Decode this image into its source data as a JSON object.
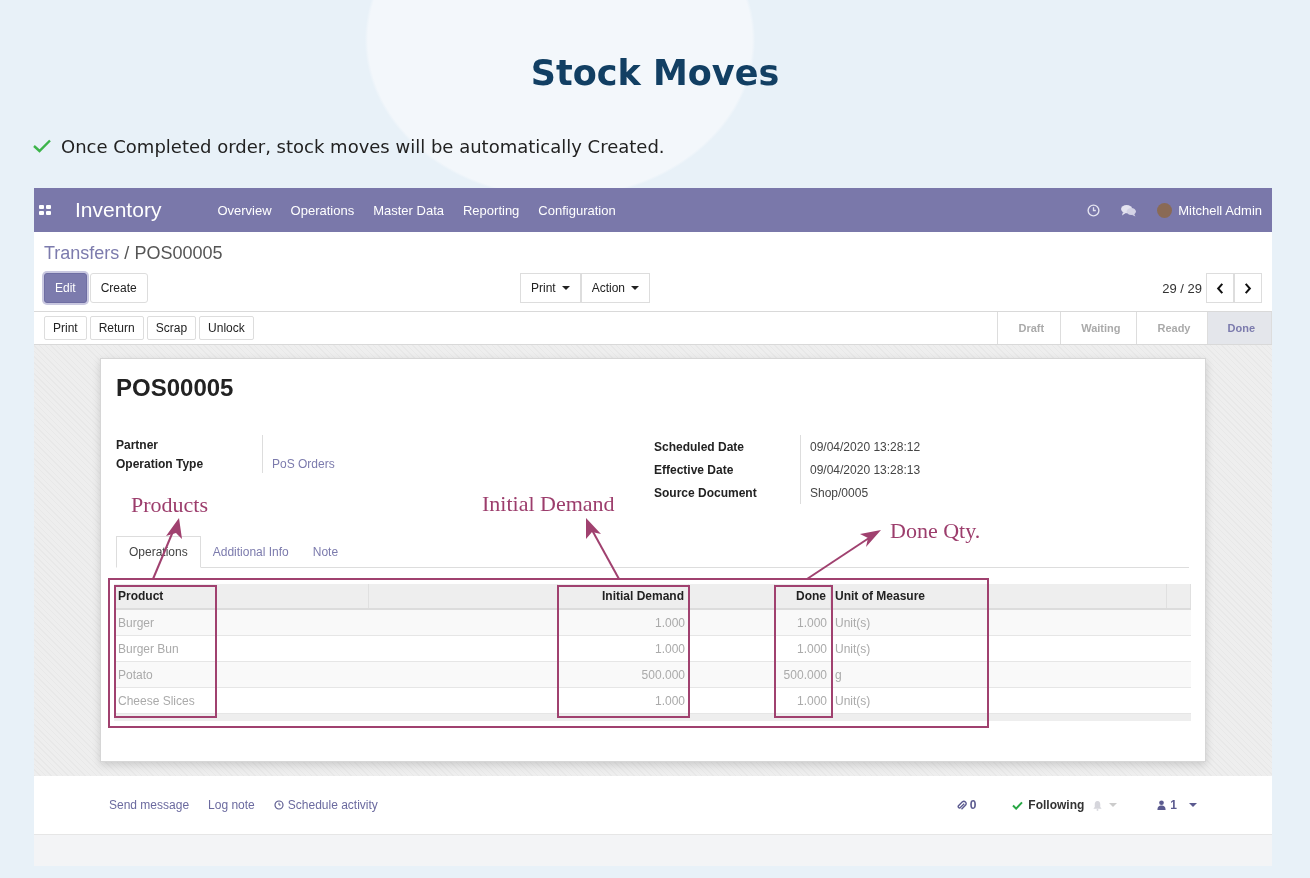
{
  "heading": "Stock Moves",
  "intro": {
    "text": "Once Completed order, stock moves will be automatically Created."
  },
  "navbar": {
    "app_name": "Inventory",
    "menu": [
      "Overview",
      "Operations",
      "Master Data",
      "Reporting",
      "Configuration"
    ],
    "user": "Mitchell Admin"
  },
  "breadcrumb": {
    "parent": "Transfers",
    "separator": "/",
    "current": "POS00005"
  },
  "buttons": [
    {
      "label": "Edit",
      "kind": "primary"
    },
    {
      "label": "Create",
      "kind": "secondary"
    }
  ],
  "dropdowns": [
    "Print",
    "Action"
  ],
  "pager": "29 / 29",
  "status_buttons": [
    "Print",
    "Return",
    "Scrap",
    "Unlock"
  ],
  "stages": [
    {
      "label": "Draft",
      "selected": false
    },
    {
      "label": "Waiting",
      "selected": false
    },
    {
      "label": "Ready",
      "selected": false
    },
    {
      "label": "Done",
      "selected": true
    }
  ],
  "record": {
    "name": "POS00005",
    "left_fields": [
      {
        "label": "Partner"
      },
      {
        "label": "Operation Type",
        "value": "PoS Orders",
        "link": true
      }
    ],
    "right_fields": [
      {
        "label": "Scheduled Date",
        "value": "09/04/2020 13:28:12",
        "link": false
      },
      {
        "label": "Effective Date",
        "value": "09/04/2020 13:28:13",
        "link": false
      },
      {
        "label": "Source Document",
        "value": "Shop/0005",
        "link": false
      }
    ]
  },
  "tabs": [
    {
      "label": "Operations",
      "selected": true
    },
    {
      "label": "Additional Info",
      "selected": false
    },
    {
      "label": "Note",
      "selected": false
    }
  ],
  "table": {
    "columns": {
      "product": "Product",
      "initial_demand": "Initial Demand",
      "done": "Done",
      "unit": "Unit of Measure"
    },
    "rows": [
      {
        "product": "Burger",
        "initial_demand": "1.000",
        "done": "1.000",
        "unit": "Unit(s)"
      },
      {
        "product": "Burger Bun",
        "initial_demand": "1.000",
        "done": "1.000",
        "unit": "Unit(s)"
      },
      {
        "product": "Potato",
        "initial_demand": "500.000",
        "done": "500.000",
        "unit": "g"
      },
      {
        "product": "Cheese Slices",
        "initial_demand": "1.000",
        "done": "1.000",
        "unit": "Unit(s)"
      }
    ]
  },
  "annotations": [
    {
      "label": "Products"
    },
    {
      "label": "Initial Demand"
    },
    {
      "label": "Done Qty."
    }
  ],
  "chatter": {
    "actions": [
      {
        "label": "Send message",
        "kind": "plain"
      },
      {
        "label": "Log note",
        "kind": "plain"
      },
      {
        "label": "Schedule activity",
        "kind": "clock"
      }
    ],
    "attachments": "0",
    "follow": "Following",
    "followers": "1"
  }
}
